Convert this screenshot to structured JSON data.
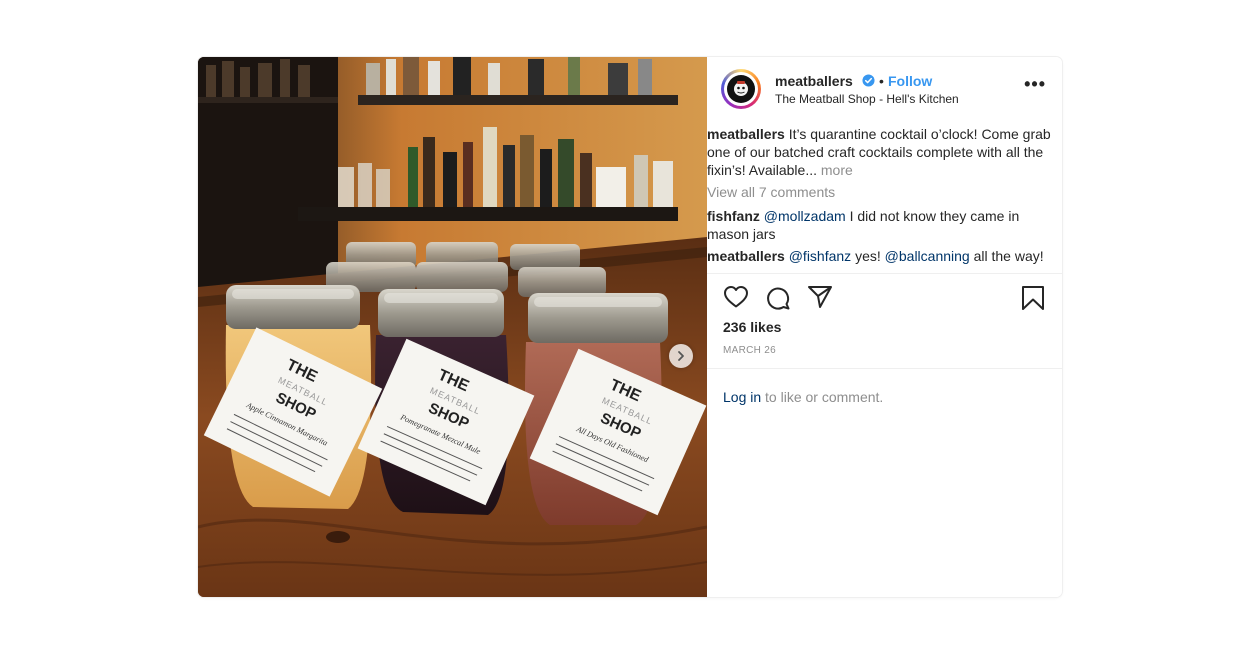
{
  "post": {
    "username": "meatballers",
    "separator": "•",
    "follow_label": "Follow",
    "location": "The Meatball Shop - Hell's Kitchen",
    "more_icon": "•••",
    "caption": {
      "username": "meatballers",
      "text": "It’s quarantine cocktail o’clock! Come grab one of our batched craft cocktails complete with all the fixin’s! Available...",
      "more_label": "more"
    },
    "view_all_comments": "View all 7 comments",
    "comments": [
      {
        "username": "fishfanz",
        "mention": "@mollzadam",
        "text": "I did not know they came in mason jars"
      },
      {
        "username": "meatballers",
        "mention": "@fishfanz",
        "text": "yes!",
        "mention2": "@ballcanning",
        "text2": "all the way!"
      }
    ],
    "likes": "236 likes",
    "date": "MARCH 26",
    "login_link": "Log in",
    "login_rest": "to like or comment."
  },
  "photo": {
    "jar_tags": [
      {
        "brand_top": "THE",
        "brand_mid": "MEATBALL",
        "brand_bottom": "SHOP",
        "drink": "Apple Cinnamon Margarita"
      },
      {
        "brand_top": "THE",
        "brand_mid": "MEATBALL",
        "brand_bottom": "SHOP",
        "drink": "Pomegranate Mezcal Mule"
      },
      {
        "brand_top": "THE",
        "brand_mid": "MEATBALL",
        "brand_bottom": "SHOP",
        "drink": "All Days Old Fashioned"
      }
    ]
  },
  "icons": {
    "verified": "verified-badge-icon",
    "like": "heart-icon",
    "comment": "comment-bubble-icon",
    "share": "paper-plane-icon",
    "save": "bookmark-icon",
    "next": "chevron-right-icon"
  },
  "colors": {
    "follow_blue": "#3897f0",
    "link_navy": "#003569",
    "muted_grey": "#8e8e8e",
    "text": "#262626"
  }
}
